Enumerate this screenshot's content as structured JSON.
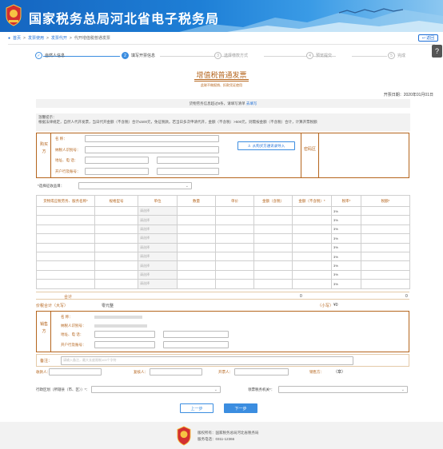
{
  "header": {
    "title": "国家税务总局河北省电子税务局",
    "emblem_caption": "中国税务"
  },
  "breadcrumb": {
    "home": "首页",
    "l1": "发票使用",
    "l2": "发票代开",
    "current": "代开增值税普通发票",
    "sep": ">"
  },
  "back_label": "返回",
  "help_icon": "?",
  "steps": [
    {
      "num": "✓",
      "label": "自然人信息",
      "state": "done"
    },
    {
      "num": "2",
      "label": "填写开票信息",
      "state": "current"
    },
    {
      "num": "3",
      "label": "选择缴款方式",
      "state": "todo"
    },
    {
      "num": "4",
      "label": "预览提交",
      "state": "todo"
    },
    {
      "num": "5",
      "label": "完成",
      "state": "todo"
    }
  ],
  "invoice": {
    "title": "增值税普通发票",
    "subtitle": "此联不做报销、扣款凭证使用",
    "date_label": "开票日期：",
    "date": "2020年01月01日"
  },
  "notice": {
    "text": "货物劳务信息超过8条，请填写清单",
    "link": "去填写"
  },
  "tip": {
    "title": "温馨提示：",
    "body": "根据法律规定，自然人代开发票，当日代开金额（不含税）合计≤500元，免征税款。若当日多次申请代开，金额（不含税）>500元，则需按金额（不含税）合计，计算开票税额"
  },
  "buyer": {
    "side_label": "购买方",
    "name_label": "名      称：",
    "taxid_label": "纳税人识别号：",
    "addr_label": "地址、电 话：",
    "bank_label": "开户行及账号：",
    "import_label": "从购买方通讯录导入",
    "password_label": "密码区"
  },
  "levy": {
    "label": "*选择征收品目：",
    "value": ""
  },
  "goods": {
    "headers": [
      "货物或应税劳务、服务名称*",
      "规格型号",
      "单位",
      "数量",
      "单价",
      "金额（含税）",
      "金额（不含税）*",
      "税率*",
      "税额*"
    ],
    "unit_placeholder": "请选择",
    "tax_rate": "3%",
    "row_count": 9
  },
  "total": {
    "label": "合计",
    "amount_incl": "0",
    "amount_excl": "0"
  },
  "total_words": {
    "label": "价税合计（大写）",
    "value": "零元整",
    "small_label": "（小写）",
    "small_value": "¥0"
  },
  "seller": {
    "side_label": "销售方",
    "name_label": "名      称：",
    "taxid_label": "纳税人识别号：",
    "addr_label": "地址、电 话：",
    "bank_label": "开户行及账号：",
    "name_value": "",
    "taxid_value": ""
  },
  "remark": {
    "label": "备注：",
    "placeholder": "请输入备注，最大长度限制100个字符"
  },
  "people": {
    "payee_label": "收款人：",
    "reviewer_label": "复核人：",
    "drawer_label": "开票人：",
    "seller_label": "销售方：",
    "seller_stamp": "（章）"
  },
  "region": {
    "label": "行政区划（所辖县（市、区））*：",
    "value": "",
    "tax_office_label": "领票税务机关*："
  },
  "buttons": {
    "prev": "上一步",
    "next": "下一步"
  },
  "footer": {
    "copyright": "版权所有：国家税务总局河北省税务局",
    "hotline": "服务电话：0311-12366"
  },
  "colors": {
    "brand_blue": "#1e6fd6",
    "invoice_brown": "#b5651d",
    "step_active": "#3b8de0"
  }
}
